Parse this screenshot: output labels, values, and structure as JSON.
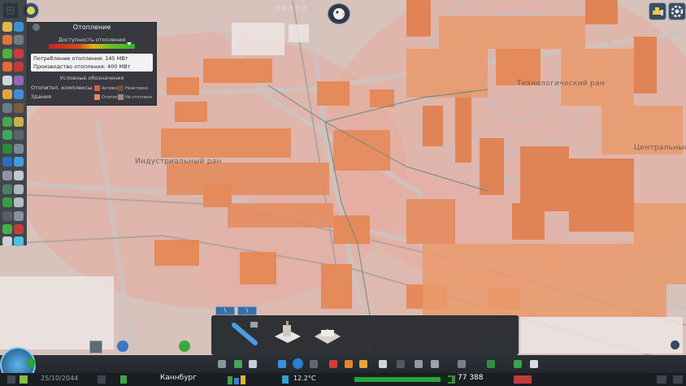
{
  "heating_panel": {
    "title": "Отопление",
    "availability_label": "Доступность отопления",
    "availability_level": 0.93,
    "consumption": "Потребление отопления: 145 МВт",
    "production": "Производство отопления: 400 МВт",
    "legend_title": "Условные обозначения",
    "legend_rows": [
      {
        "label": "Отопител. комплексы",
        "items": [
          {
            "label": "Активно",
            "color": "#d95b4b"
          },
          {
            "label": "Неактивно",
            "color": "#7a4b3a"
          }
        ]
      },
      {
        "label": "Здания",
        "items": [
          {
            "label": "Отоплено",
            "color": "#e58a5a"
          },
          {
            "label": "Не отоплено",
            "color": "#a7837d"
          }
        ]
      }
    ]
  },
  "district_labels": {
    "industrial": "Индустриальный ран",
    "technological": "Технологический ран",
    "central": "Центральный"
  },
  "tool_tabs": [
    "\\",
    "\\"
  ],
  "bottom_bar": {
    "date": "25/10/2044",
    "city_name": "Каннбург",
    "temperature": "12.2°C",
    "money": "77 388",
    "population_progress": 0.88
  },
  "colors": {
    "heated_building": "#e58a5a",
    "map_ground": "#d9c4bd",
    "heating_zone": "#e8a89c",
    "road": "#bfb7b5",
    "accent": "#3c6fa3"
  },
  "icons": {
    "top_left": [
      "grid-icon",
      "pause-icon"
    ],
    "top_right": [
      "bulldozer-icon",
      "gear-icon"
    ],
    "top_center": "chirper-bird-icon"
  }
}
